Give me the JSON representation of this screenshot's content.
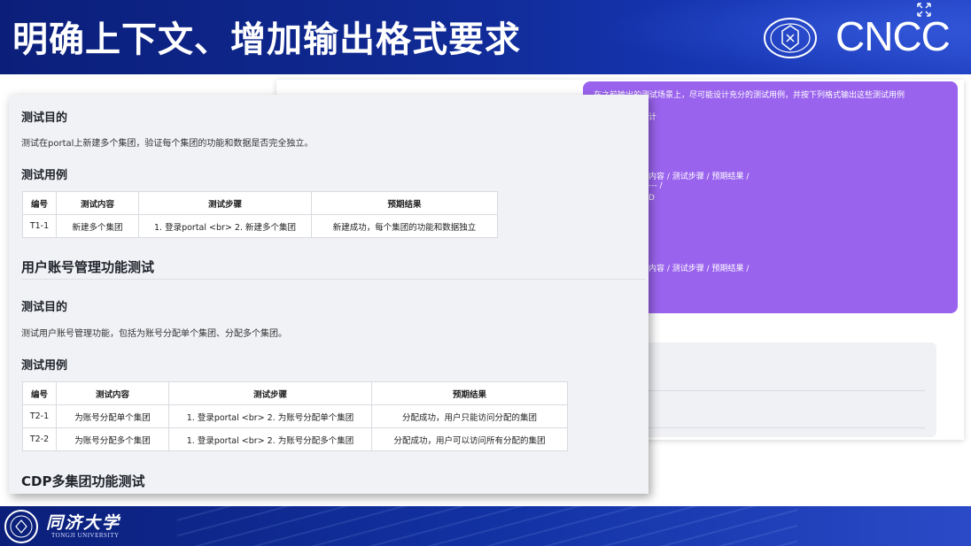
{
  "slide": {
    "title": "明确上下文、增加输出格式要求",
    "brand": "CNCC",
    "ccf_logo_icon": "ccf-seal-icon"
  },
  "background_chat": {
    "prompt_lines": [
      "在之前输出的测试场景上，尽可能设计充分的测试用例，并按下列格式输出这些测试用例",
      "计",
      "内容 / 测试步骤 / 预期结果 /",
      "--- /",
      "D",
      "内容 / 测试步骤 / 预期结果 /"
    ],
    "colors": {
      "bubble": "#9a63ee"
    }
  },
  "doc": {
    "section1": {
      "purpose_heading": "测试目的",
      "purpose_text": "测试在portal上新建多个集团，验证每个集团的功能和数据是否完全独立。",
      "cases_heading": "测试用例",
      "table": {
        "headers": [
          "编号",
          "测试内容",
          "测试步骤",
          "预期结果"
        ],
        "rows": [
          [
            "T1-1",
            "新建多个集团",
            "1. 登录portal <br> 2. 新建多个集团",
            "新建成功，每个集团的功能和数据独立"
          ]
        ]
      }
    },
    "section2": {
      "title": "用户账号管理功能测试",
      "purpose_heading": "测试目的",
      "purpose_text": "测试用户账号管理功能，包括为账号分配单个集团、分配多个集团。",
      "cases_heading": "测试用例",
      "table": {
        "headers": [
          "编号",
          "测试内容",
          "测试步骤",
          "预期结果"
        ],
        "rows": [
          [
            "T2-1",
            "为账号分配单个集团",
            "1. 登录portal <br> 2. 为账号分配单个集团",
            "分配成功，用户只能访问分配的集团"
          ],
          [
            "T2-2",
            "为账号分配多个集团",
            "1. 登录portal <br> 2. 为账号分配多个集团",
            "分配成功，用户可以访问所有分配的集团"
          ]
        ]
      }
    },
    "section3": {
      "title": "CDP多集团功能测试"
    }
  },
  "footer": {
    "university_cn": "同济大学",
    "university_en": "TONGJI UNIVERSITY"
  }
}
